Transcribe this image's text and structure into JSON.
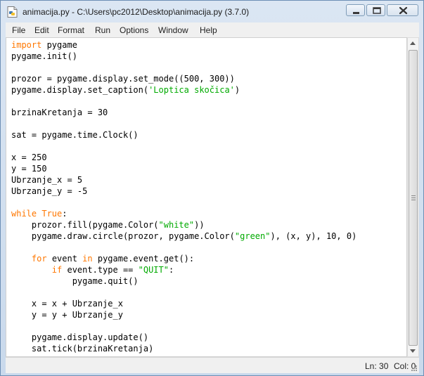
{
  "window": {
    "title": "animacija.py - C:\\Users\\pc2012\\Desktop\\animacija.py (3.7.0)",
    "icon": "python-file-icon"
  },
  "menu": [
    "File",
    "Edit",
    "Format",
    "Run",
    "Options",
    "Window",
    "Help"
  ],
  "code": [
    "import pygame",
    "pygame.init()",
    "",
    "prozor = pygame.display.set_mode((500, 300))",
    "pygame.display.set_caption('Loptica skočica')",
    "",
    "brzinaKretanja = 30",
    "",
    "sat = pygame.time.Clock()",
    "",
    "x = 250",
    "y = 150",
    "Ubrzanje_x = 5",
    "Ubrzanje_y = -5",
    "",
    "while True:",
    "    prozor.fill(pygame.Color(\"white\"))",
    "    pygame.draw.circle(prozor, pygame.Color(\"green\"), (x, y), 10, 0)",
    "",
    "    for event in pygame.event.get():",
    "        if event.type == \"QUIT\":",
    "            pygame.quit()",
    "",
    "    x = x + Ubrzanje_x",
    "    y = y + Ubrzanje_y",
    "",
    "    pygame.display.update()",
    "    sat.tick(brzinaKretanja)"
  ],
  "status": {
    "line": "Ln: 30",
    "col": "Col: 0"
  },
  "syntax_colors": {
    "keyword": "#ff7700",
    "string": "#00aa00",
    "text": "#000000"
  }
}
